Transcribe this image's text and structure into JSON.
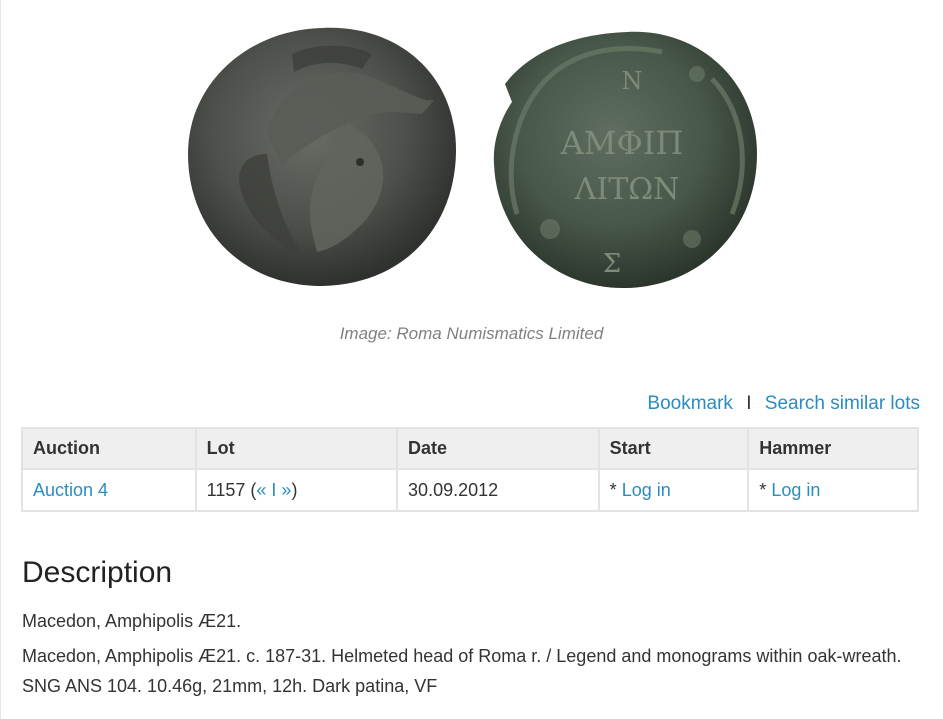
{
  "image": {
    "caption": "Image: Roma Numismatics Limited",
    "obverse_legend": [],
    "reverse_legend": [
      "ΑΜΦΙΠ",
      "ΛΙΤΩΝ"
    ],
    "reverse_marks": [
      "Ν",
      "Σ"
    ]
  },
  "actions": {
    "bookmark": "Bookmark",
    "separator": "I",
    "search_similar": "Search similar lots"
  },
  "table": {
    "headers": [
      "Auction",
      "Lot",
      "Date",
      "Start",
      "Hammer"
    ],
    "row": {
      "auction": "Auction 4",
      "lot_number": "1157",
      "lot_prev": "«",
      "lot_sep": "I",
      "lot_next": "»",
      "date": "30.09.2012",
      "start_prefix": "*",
      "start_link": "Log in",
      "hammer_prefix": "*",
      "hammer_link": "Log in"
    }
  },
  "description": {
    "title": "Description",
    "short": "Macedon, Amphipolis Æ21.",
    "long": "Macedon, Amphipolis Æ21. c. 187-31. Helmeted head of Roma r. / Legend and monograms within oak-wreath. SNG ANS 104. 10.46g, 21mm, 12h. Dark patina, VF"
  },
  "colors": {
    "link": "#2a8dc0",
    "coin_obverse": "#4a4f4a",
    "coin_reverse": "#3f5547"
  }
}
